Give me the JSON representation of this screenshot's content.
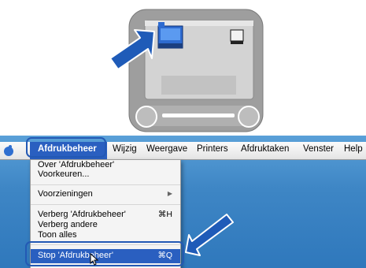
{
  "menubar": {
    "active_menu": "Afdrukbeheer",
    "items": [
      "Wijzig",
      "Weergave",
      "Printers",
      "Afdruktaken",
      "Venster",
      "Help"
    ]
  },
  "menu": {
    "items": [
      {
        "label": "Over 'Afdrukbeheer'",
        "shortcut": ""
      },
      {
        "label": "Voorkeuren...",
        "shortcut": ""
      },
      {
        "label": "Voorzieningen",
        "shortcut": "▶"
      },
      {
        "label": "Verberg 'Afdrukbeheer'",
        "shortcut": "⌘H"
      },
      {
        "label": "Verberg andere",
        "shortcut": ""
      },
      {
        "label": "Toon alles",
        "shortcut": ""
      },
      {
        "label": "Stop 'Afdrukbeheer'",
        "shortcut": "⌘Q"
      }
    ]
  },
  "colors": {
    "accent": "#2a5fc0",
    "callout": "#2359b4",
    "desktop": "#3d86c6",
    "monitor": "#9e9e9e"
  },
  "icons": [
    "apple-icon",
    "arrow-icon",
    "hard-drive-icon",
    "printer-folder-icon",
    "mouse-pointer-icon"
  ]
}
